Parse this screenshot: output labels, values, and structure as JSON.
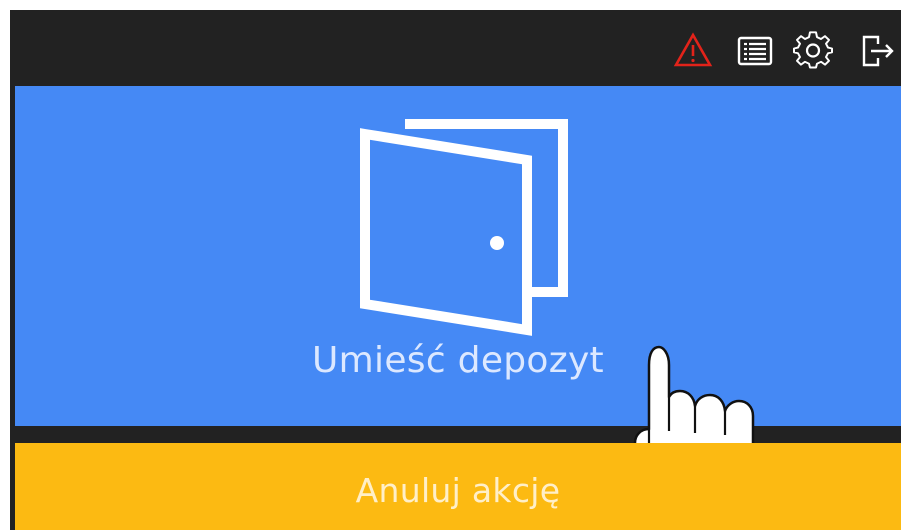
{
  "topbar": {
    "icons": {
      "warning": "warning-icon",
      "list": "list-icon",
      "settings": "gear-icon",
      "logout": "logout-icon"
    },
    "colors": {
      "background": "#222222",
      "warning": "#E2231A",
      "icon": "#FFFFFF"
    }
  },
  "main": {
    "deposit_label": "Umieść depozyt",
    "deposit_icon": "door-icon",
    "hint_icon": "pointing-hand-icon",
    "colors": {
      "background": "#4589F5",
      "label": "#DCE8FF"
    }
  },
  "footer": {
    "cancel_label": "Anuluj akcję",
    "colors": {
      "background": "#FCBA12",
      "label": "#FFEFC8"
    }
  }
}
